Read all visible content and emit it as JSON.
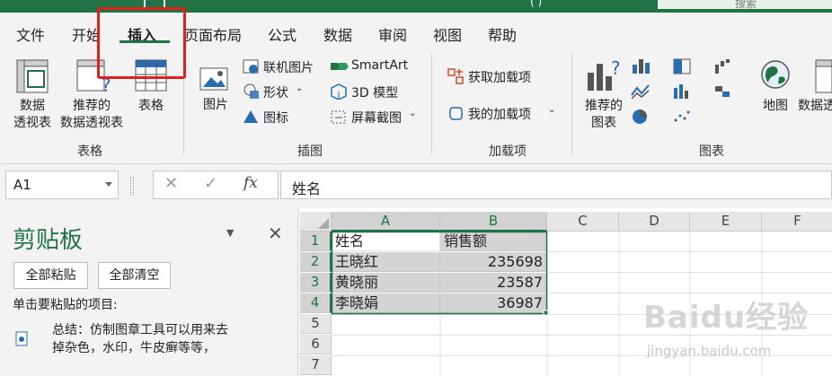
{
  "window": {
    "paren_text": "( )",
    "search_placeholder": "搜索"
  },
  "tabs": [
    {
      "label": "文件"
    },
    {
      "label": "开始"
    },
    {
      "label": "插入"
    },
    {
      "label": "页面布局"
    },
    {
      "label": "公式"
    },
    {
      "label": "数据"
    },
    {
      "label": "审阅"
    },
    {
      "label": "视图"
    },
    {
      "label": "帮助"
    }
  ],
  "active_tab": "插入",
  "ribbon": {
    "tables": {
      "group": "表格",
      "pivot": [
        "数据",
        "透视表"
      ],
      "recommended_pivot": [
        "推荐的",
        "数据透视表"
      ],
      "table": "表格"
    },
    "illustrations": {
      "group": "插图",
      "picture": "图片",
      "online_picture": "联机图片",
      "shapes": "形状",
      "icons": "图标",
      "smartart": "SmartArt",
      "model3d": "3D 模型",
      "screenshot": "屏幕截图"
    },
    "addins": {
      "group": "加载项",
      "get": "获取加载项",
      "my": "我的加载项"
    },
    "charts": {
      "group": "图表",
      "recommended": [
        "推荐的",
        "图表"
      ],
      "maps": "地图",
      "pivot_chart": "数据透"
    }
  },
  "formula_bar": {
    "name_box": "A1",
    "value": "姓名"
  },
  "clipboard": {
    "title": "剪贴板",
    "paste_all": "全部粘贴",
    "clear_all": "全部清空",
    "hint": "单击要粘贴的项目:",
    "item_lines": [
      "总结：仿制图章工具可以用来去",
      "掉杂色，水印，牛皮癣等等，"
    ]
  },
  "sheet": {
    "columns": [
      "A",
      "B",
      "C",
      "D",
      "E",
      "F"
    ],
    "rows": [
      "1",
      "2",
      "3",
      "4",
      "5",
      "6",
      "7"
    ],
    "cells": [
      [
        "姓名",
        "销售额"
      ],
      [
        "王晓红",
        "235698"
      ],
      [
        "黄晓丽",
        "23587"
      ],
      [
        "李晓娟",
        "36987"
      ]
    ]
  },
  "watermark": {
    "brand": "Baidu经验",
    "url": "jingyan.baidu.com"
  },
  "colors": {
    "accent": "#217346",
    "highlight": "#e02020"
  }
}
